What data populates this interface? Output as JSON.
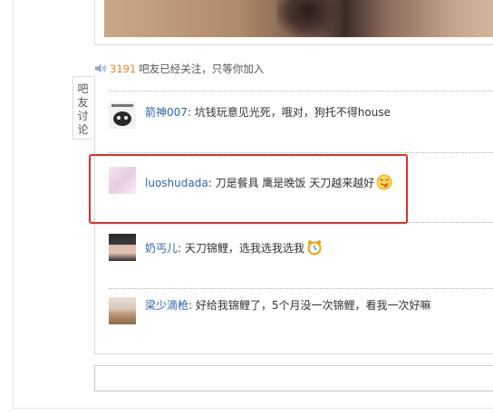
{
  "follow": {
    "count": "3191",
    "text": "吧友已经关注，只等你加入"
  },
  "side_tab": {
    "chars": [
      "吧",
      "友",
      "讨",
      "论"
    ]
  },
  "comments": [
    {
      "user": "箭神007",
      "sep": ":",
      "text": "坑钱玩意见光死，哦对，狗托不得house"
    },
    {
      "user": "luoshudada",
      "sep": ":",
      "text": "刀是餐具 鹰是晚饭 天刀越来越好"
    },
    {
      "user": "奶丐儿",
      "sep": ":",
      "text": "天刀锦鲤，选我选我选我"
    },
    {
      "user": "梁少滴枪",
      "sep": ":",
      "text": "好给我锦鲤了，5个月没一次锦鲤，看我一次好嘛"
    }
  ],
  "icons": {
    "follow": "speaker-icon",
    "emoji_comment_2": "smiley-tongue-emoji-icon",
    "emoji_comment_3": "alarm-clock-emoji-icon"
  },
  "colors": {
    "accent_count": "#e8842b",
    "username": "#2d64b3",
    "highlight": "#dc2e2a"
  }
}
